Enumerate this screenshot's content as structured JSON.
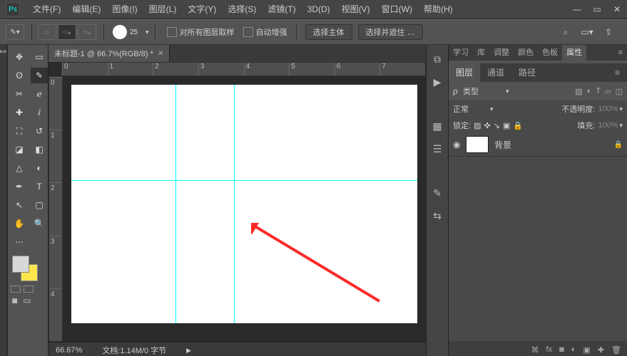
{
  "menu": {
    "items": [
      "文件(F)",
      "编辑(E)",
      "图像(I)",
      "图层(L)",
      "文字(Y)",
      "选择(S)",
      "滤镜(T)",
      "3D(D)",
      "视图(V)",
      "窗口(W)",
      "帮助(H)"
    ]
  },
  "options": {
    "brush_size": "25",
    "sample_all": "对所有图层取样",
    "auto_enhance": "自动增强",
    "select_subject": "选择主体",
    "select_and_mask": "选择并遮住 …"
  },
  "document": {
    "tab": "未标题-1 @ 66.7%(RGB/8) *"
  },
  "ruler_h": [
    "0",
    "1",
    "2",
    "3",
    "4",
    "5",
    "6",
    "7"
  ],
  "ruler_v": [
    "0",
    "1",
    "2",
    "3",
    "4"
  ],
  "guides": {
    "v1": 30,
    "v2": 47,
    "h1": 40
  },
  "status": {
    "zoom": "66.67%",
    "docinfo": "文档:1.14M/0 字节"
  },
  "panel_tabs_top": [
    "学习",
    "库",
    "调整",
    "颜色",
    "色板",
    "属性"
  ],
  "panel_tabs_mid": [
    "图层",
    "通道",
    "路径"
  ],
  "layers_panel": {
    "filter_label": "类型",
    "blend_mode": "正常",
    "opacity_label": "不透明度:",
    "opacity_value": "100%",
    "lock_label": "锁定:",
    "fill_label": "填充:",
    "fill_value": "100%",
    "layer_name": "背景"
  }
}
